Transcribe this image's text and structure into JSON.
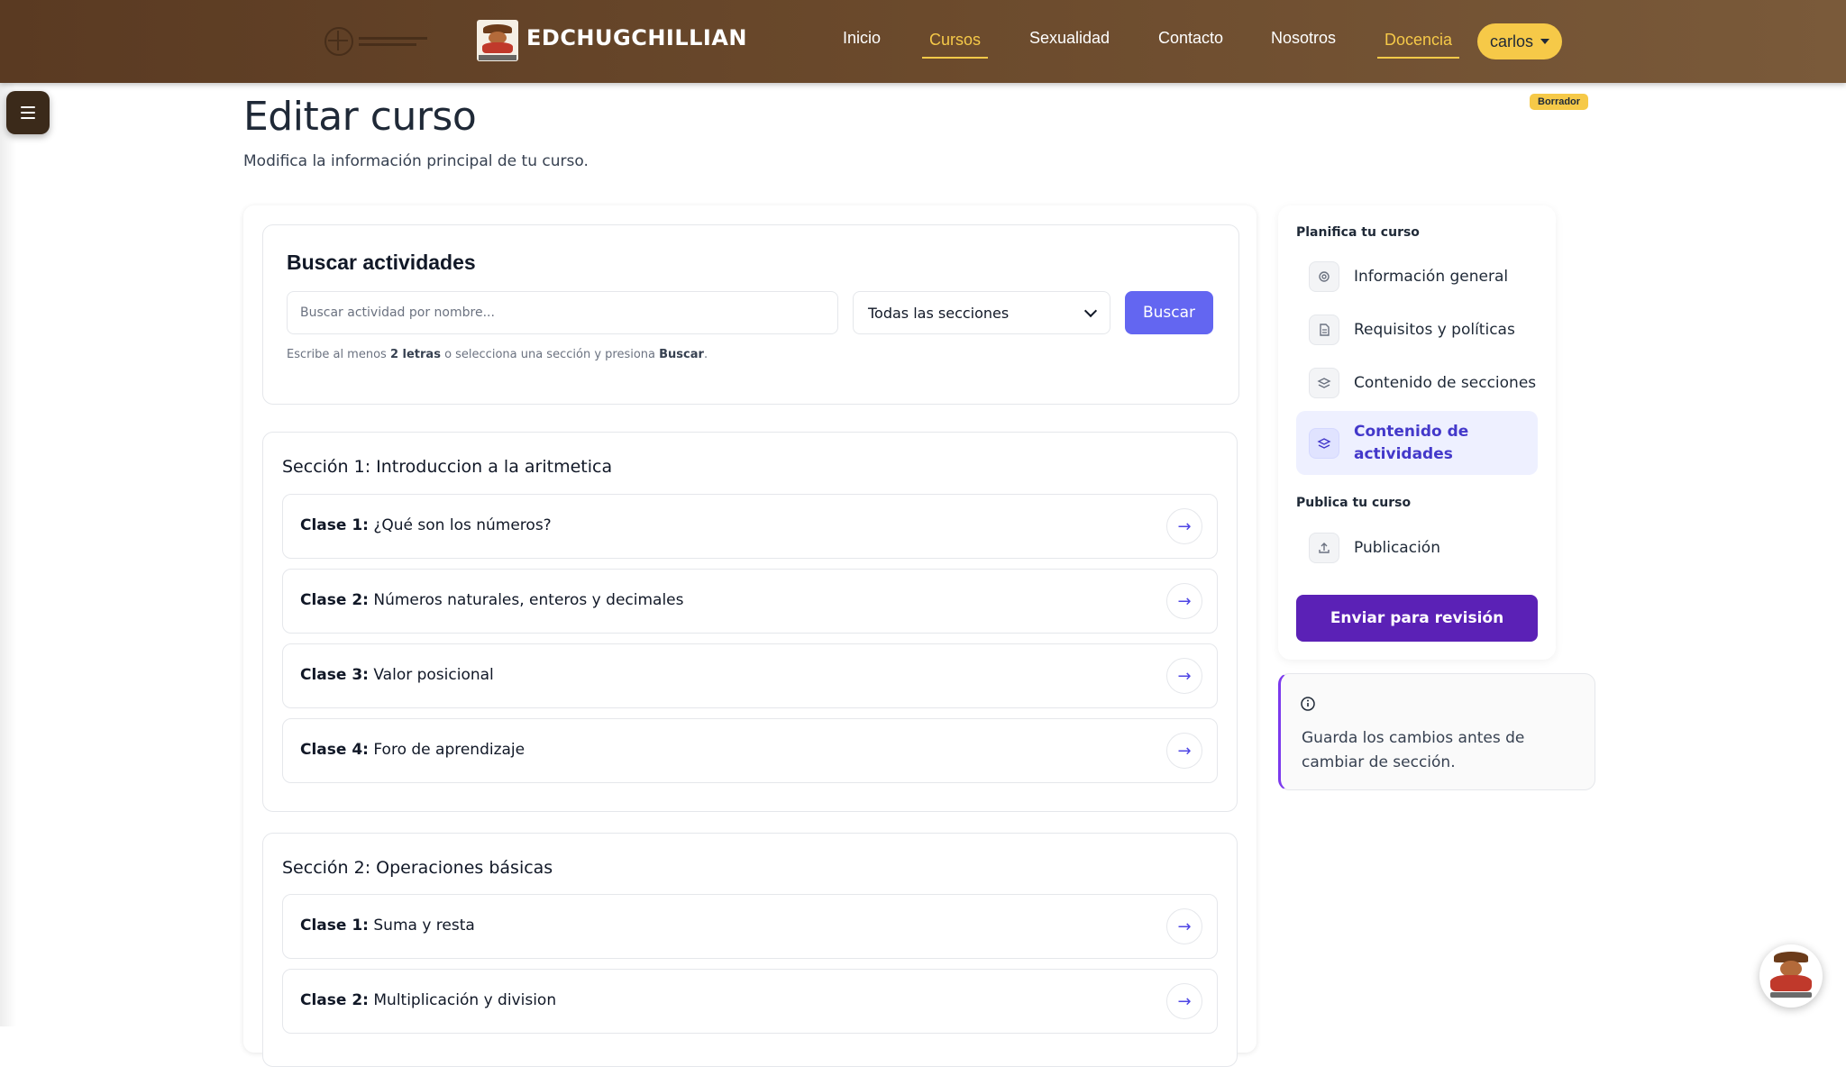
{
  "nav": {
    "brand": "EDCHUGCHILLIAN",
    "links": [
      {
        "label": "Inicio",
        "active": false
      },
      {
        "label": "Cursos",
        "active": true
      },
      {
        "label": "Sexualidad",
        "active": false
      },
      {
        "label": "Contacto",
        "active": false
      },
      {
        "label": "Nosotros",
        "active": false
      },
      {
        "label": "Docencia",
        "active": true
      }
    ],
    "user": "carlos"
  },
  "header": {
    "title": "Editar curso",
    "subtitle": "Modifica la información principal de tu curso.",
    "status": "Borrador"
  },
  "search": {
    "title": "Buscar actividades",
    "placeholder": "Buscar actividad por nombre...",
    "select_value": "Todas las secciones",
    "button": "Buscar",
    "hint_prefix": "Escribe al menos ",
    "hint_bold1": "2 letras",
    "hint_middle": " o selecciona una sección y presiona ",
    "hint_bold2": "Buscar",
    "hint_suffix": "."
  },
  "sections": [
    {
      "title": "Sección 1: Introduccion a la aritmetica",
      "classes": [
        {
          "prefix": "Clase 1:",
          "name": "¿Qué son los números?"
        },
        {
          "prefix": "Clase 2:",
          "name": "Números naturales, enteros y decimales"
        },
        {
          "prefix": "Clase 3:",
          "name": "Valor posicional"
        },
        {
          "prefix": "Clase 4:",
          "name": "Foro de aprendizaje"
        }
      ]
    },
    {
      "title": "Sección 2: Operaciones básicas",
      "classes": [
        {
          "prefix": "Clase 1:",
          "name": "Suma y resta"
        },
        {
          "prefix": "Clase 2:",
          "name": "Multiplicación y division"
        }
      ]
    }
  ],
  "sidebar": {
    "plan_heading": "Planifica tu curso",
    "items": [
      {
        "label": "Información general",
        "icon": "gear-icon",
        "active": false
      },
      {
        "label": "Requisitos y políticas",
        "icon": "document-icon",
        "active": false
      },
      {
        "label": "Contenido de secciones",
        "icon": "layers-icon",
        "active": false
      },
      {
        "label": "Contenido de actividades",
        "icon": "layers-icon",
        "active": true
      }
    ],
    "publish_heading": "Publica tu curso",
    "publish_item": {
      "label": "Publicación",
      "icon": "upload-icon"
    },
    "submit_button": "Enviar para revisión"
  },
  "note": {
    "icon": "info-icon",
    "text": "Guarda los cambios antes de cambiar de sección."
  },
  "colors": {
    "nav_start": "#5a3a22",
    "nav_end": "#7a5a3a",
    "accent_yellow": "#f6c948",
    "primary": "#6366f1",
    "submit": "#5b21b6",
    "note_border": "#7c3aed"
  }
}
